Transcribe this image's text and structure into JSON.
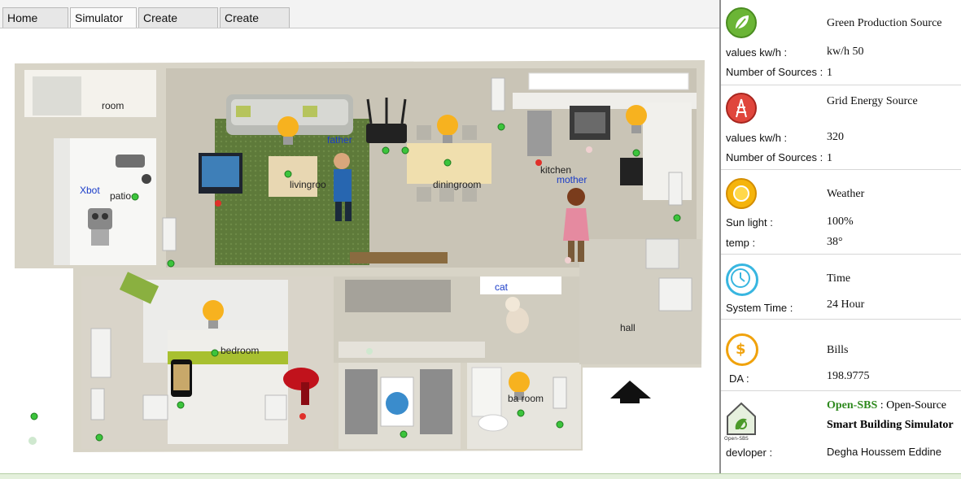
{
  "tabs": [
    {
      "label": "Home Maps"
    },
    {
      "label": "Simulator ✕"
    },
    {
      "label": "Create Scenario"
    },
    {
      "label": "Create things"
    }
  ],
  "rooms": {
    "room": "room",
    "patio": "patio",
    "livingroom": "livingroo",
    "diningroom": "diningroom",
    "kitchen": "kitchen",
    "bedroom": "bedroom",
    "bathroom": "ba  room",
    "hall": "hall"
  },
  "agents": {
    "xbot": "Xbot",
    "father": "father",
    "mother": "mother",
    "cat": "cat"
  },
  "panel": {
    "green": {
      "title": "Green Production Source",
      "values_label": "values kw/h :",
      "values": "kw/h 50",
      "sources_label": "Number of Sources :",
      "sources": "1",
      "color": "#6bb536"
    },
    "grid": {
      "title": "Grid Energy Source",
      "values_label": "values kw/h :",
      "values": "320",
      "sources_label": "Number of Sources :",
      "sources": "1",
      "color": "#e0463c"
    },
    "weather": {
      "title": "Weather",
      "sun_label": "Sun light :",
      "sun": "100%",
      "temp_label": "temp :",
      "temp": "38°",
      "color": "#f5b40c"
    },
    "time": {
      "title": "Time",
      "label": "System Time :",
      "value": "24 Hour",
      "color": "#38b6e0"
    },
    "bills": {
      "title": "Bills",
      "label": "DA :",
      "value": "198.9775",
      "color": "#f0a20c"
    },
    "about": {
      "name": "Open-SBS",
      "sep": " : ",
      "desc1": "Open-Source",
      "desc2": "Smart Building Simulator",
      "logo_text": "Open-SBS",
      "dev_label": "devloper :",
      "dev_name": "Degha Houssem Eddine"
    }
  }
}
